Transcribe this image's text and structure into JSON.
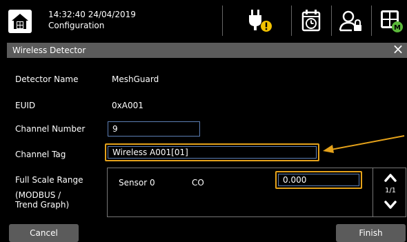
{
  "header": {
    "datetime": "14:32:40 24/04/2019",
    "screen_title": "Configuration"
  },
  "icons": {
    "home": "home-icon",
    "power_warning": "power-plug-warning-icon",
    "calendar": "calendar-clock-icon",
    "user_lock": "user-lock-icon",
    "menu_grid": "grid-menu-icon"
  },
  "colors": {
    "highlight": "#e5a21a",
    "input_border": "#5d7fb5",
    "titlebar": "#5b5b5b",
    "warning": "#f2c200",
    "status_green": "#5bb83a"
  },
  "dialog": {
    "title": "Wireless Detector",
    "close_label": "×",
    "detector_name_label": "Detector Name",
    "detector_name_value": "MeshGuard",
    "euid_label": "EUID",
    "euid_value": "0xA001",
    "channel_number_label": "Channel Number",
    "channel_number_value": "9",
    "channel_tag_label": "Channel Tag",
    "channel_tag_value": "Wireless A001[01]",
    "full_scale_label": "Full Scale Range",
    "full_scale_sub1": "(MODBUS /",
    "full_scale_sub2": "Trend Graph)",
    "sensor_label": "Sensor 0",
    "sensor_gas": "CO",
    "sensor_value": "0.000",
    "page_indicator": "1/1",
    "cancel_label": "Cancel",
    "finish_label": "Finish"
  }
}
